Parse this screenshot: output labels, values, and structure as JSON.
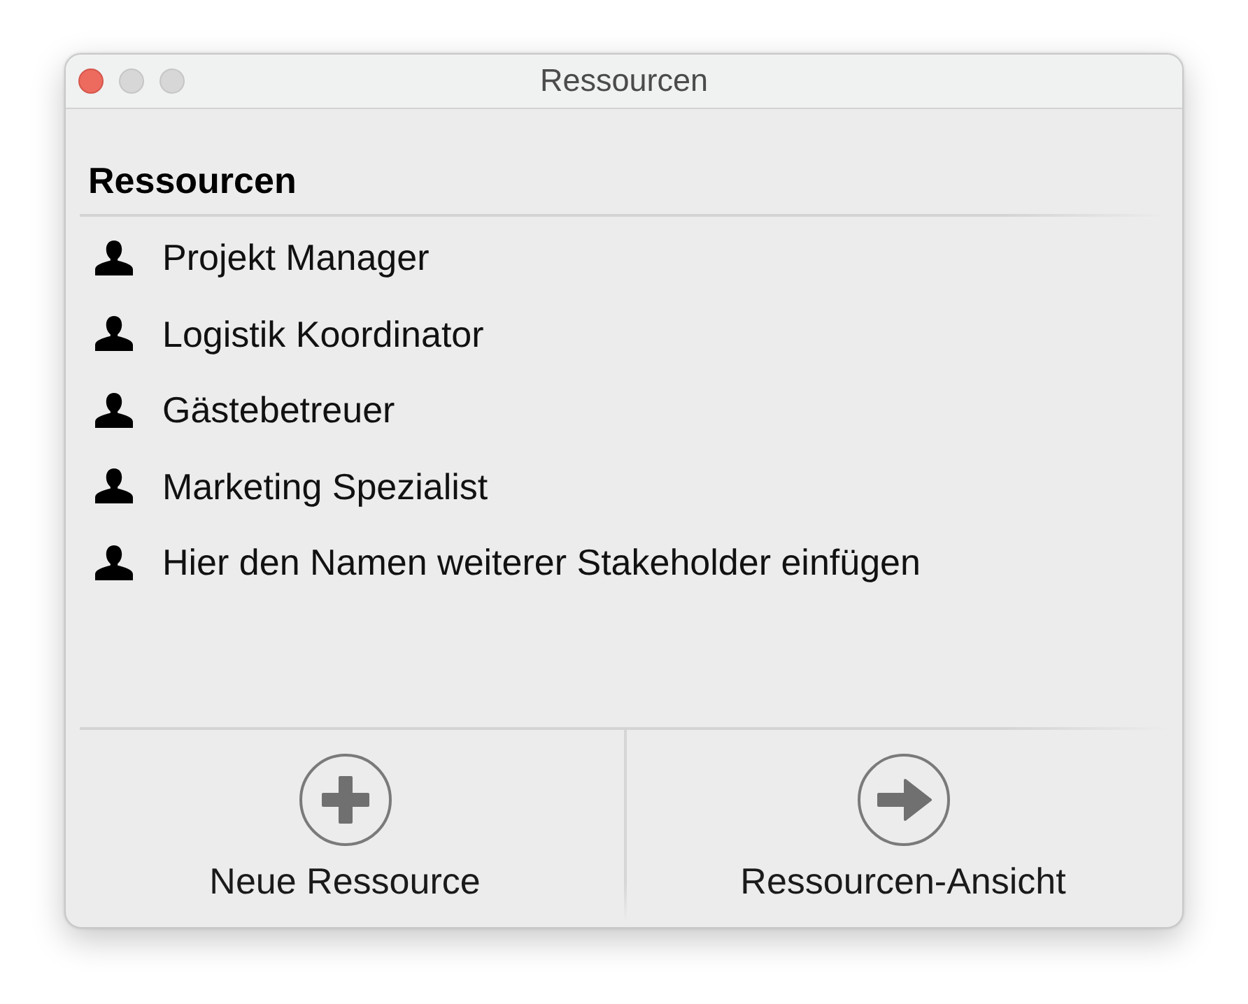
{
  "window": {
    "title": "Ressourcen",
    "controls": [
      {
        "kind": "close",
        "disabled": false
      },
      {
        "kind": "minimize",
        "disabled": true
      },
      {
        "kind": "zoom",
        "disabled": true
      }
    ]
  },
  "section": {
    "heading": "Ressourcen",
    "items": [
      {
        "label": "Projekt Manager"
      },
      {
        "label": "Logistik Koordinator"
      },
      {
        "label": "Gästebetreuer"
      },
      {
        "label": "Marketing Spezialist"
      },
      {
        "label": "Hier den Namen weiterer Stakeholder einfügen"
      }
    ]
  },
  "actions": [
    {
      "kind": "add",
      "label": "Neue Ressource"
    },
    {
      "kind": "view",
      "label": "Ressourcen-Ansicht"
    }
  ]
}
